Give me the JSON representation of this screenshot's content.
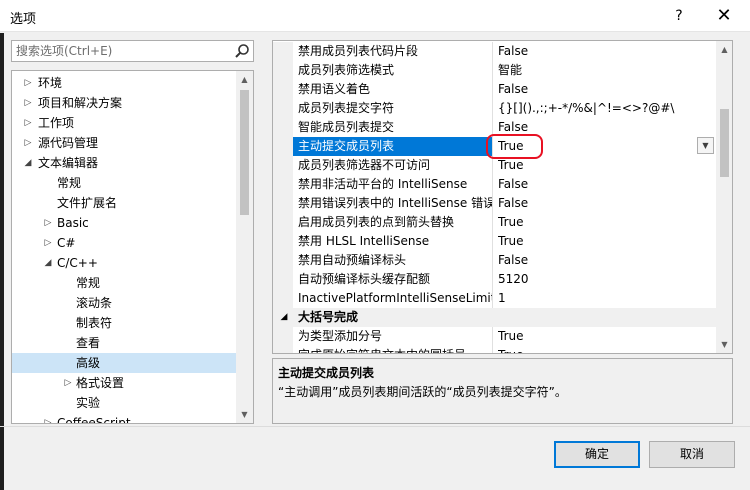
{
  "window": {
    "title": "选项",
    "help_icon": "?",
    "close_icon": "✕"
  },
  "search": {
    "placeholder": "搜索选项(Ctrl+E)"
  },
  "tree": {
    "items": [
      {
        "label": "环境",
        "indent": 0,
        "arrow": "▷"
      },
      {
        "label": "项目和解决方案",
        "indent": 0,
        "arrow": "▷"
      },
      {
        "label": "工作项",
        "indent": 0,
        "arrow": "▷"
      },
      {
        "label": "源代码管理",
        "indent": 0,
        "arrow": "▷"
      },
      {
        "label": "文本编辑器",
        "indent": 0,
        "arrow": "◢"
      },
      {
        "label": "常规",
        "indent": 1,
        "arrow": ""
      },
      {
        "label": "文件扩展名",
        "indent": 1,
        "arrow": ""
      },
      {
        "label": "Basic",
        "indent": 1,
        "arrow": "▷"
      },
      {
        "label": "C#",
        "indent": 1,
        "arrow": "▷"
      },
      {
        "label": "C/C++",
        "indent": 1,
        "arrow": "◢"
      },
      {
        "label": "常规",
        "indent": 2,
        "arrow": ""
      },
      {
        "label": "滚动条",
        "indent": 2,
        "arrow": ""
      },
      {
        "label": "制表符",
        "indent": 2,
        "arrow": ""
      },
      {
        "label": "查看",
        "indent": 2,
        "arrow": ""
      },
      {
        "label": "高级",
        "indent": 2,
        "arrow": "",
        "selected": true
      },
      {
        "label": "格式设置",
        "indent": 2,
        "arrow": "▷"
      },
      {
        "label": "实验",
        "indent": 2,
        "arrow": ""
      },
      {
        "label": "CoffeeScript",
        "indent": 1,
        "arrow": "▷"
      }
    ]
  },
  "grid": {
    "rows": [
      {
        "name": "禁用成员列表代码片段",
        "value": "False"
      },
      {
        "name": "成员列表筛选模式",
        "value": "智能"
      },
      {
        "name": "禁用语义着色",
        "value": "False"
      },
      {
        "name": "成员列表提交字符",
        "value": "{}[]().,:;+-*/%&|^!=<>?@#\\"
      },
      {
        "name": "智能成员列表提交",
        "value": "False"
      },
      {
        "name": "主动提交成员列表",
        "value": "True",
        "selected": true
      },
      {
        "name": "成员列表筛选器不可访问",
        "value": "True"
      },
      {
        "name": "禁用非活动平台的 IntelliSense",
        "value": "False"
      },
      {
        "name": "禁用错误列表中的 IntelliSense 错误",
        "value": "False"
      },
      {
        "name": "启用成员列表的点到箭头替换",
        "value": "True"
      },
      {
        "name": "禁用 HLSL IntelliSense",
        "value": "True"
      },
      {
        "name": "禁用自动预编译标头",
        "value": "False"
      },
      {
        "name": "自动预编译标头缓存配额",
        "value": "5120"
      },
      {
        "name": "InactivePlatformIntelliSenseLimit",
        "value": "1"
      }
    ],
    "category": {
      "label": "大括号完成",
      "arrow": "◢"
    },
    "rows2": [
      {
        "name": "为类型添加分号",
        "value": "True"
      },
      {
        "name": "完成原始字符串文本中的圆括号",
        "value": "True"
      }
    ]
  },
  "description": {
    "title": "主动提交成员列表",
    "text": "“主动调用”成员列表期间活跃的“成员列表提交字符”。"
  },
  "buttons": {
    "ok": "确定",
    "cancel": "取消"
  },
  "colors": {
    "selection": "#0078d7",
    "tree_selection": "#cce4f7",
    "annotation": "#e81123"
  }
}
